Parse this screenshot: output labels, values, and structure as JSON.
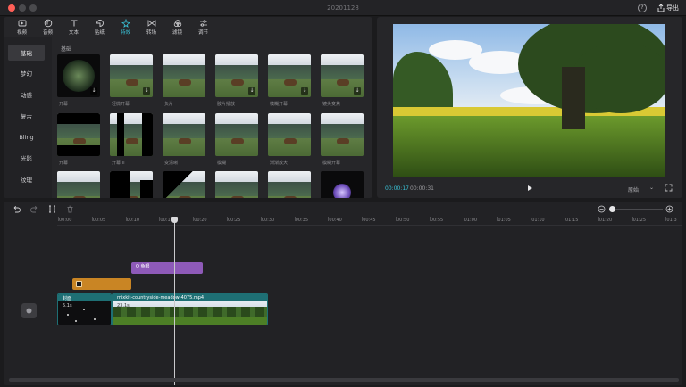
{
  "window": {
    "title": "20201128",
    "export_label": "导出",
    "help_label": "?"
  },
  "colors": {
    "accent": "#39c2d7",
    "text_clip": "#8e5ab8",
    "sticker_clip": "#c98524",
    "video_clip": "#1e6f74"
  },
  "tabs": [
    {
      "label": "视频",
      "icon": "video-icon"
    },
    {
      "label": "音频",
      "icon": "music-icon"
    },
    {
      "label": "文本",
      "icon": "text-icon"
    },
    {
      "label": "贴纸",
      "icon": "sticker-icon"
    },
    {
      "label": "特效",
      "icon": "effects-icon",
      "active": true
    },
    {
      "label": "转场",
      "icon": "transition-icon"
    },
    {
      "label": "滤镜",
      "icon": "filter-icon"
    },
    {
      "label": "调节",
      "icon": "adjust-icon"
    }
  ],
  "categories": [
    {
      "label": "基础",
      "active": true
    },
    {
      "label": "梦幻"
    },
    {
      "label": "动感"
    },
    {
      "label": "复古"
    },
    {
      "label": "Bling"
    },
    {
      "label": "光影"
    },
    {
      "label": "纹理"
    },
    {
      "label": "漫画"
    }
  ],
  "effects": {
    "section_label": "基础",
    "items": [
      {
        "label": "开幕",
        "variant": "circle",
        "downloaded": false
      },
      {
        "label": "轻微开幕",
        "variant": "plain"
      },
      {
        "label": "负片",
        "variant": "plain"
      },
      {
        "label": "胶片播放",
        "variant": "plain"
      },
      {
        "label": "模糊开幕",
        "variant": "plain"
      },
      {
        "label": "镜头变焦",
        "variant": "plain"
      },
      {
        "label": "开幕",
        "variant": "black-bars"
      },
      {
        "label": "开幕 II",
        "variant": "split"
      },
      {
        "label": "变清晰",
        "variant": "plain"
      },
      {
        "label": "模糊",
        "variant": "plain"
      },
      {
        "label": "渐渐放大",
        "variant": "plain"
      },
      {
        "label": "模糊开幕",
        "variant": "plain"
      },
      {
        "label": "",
        "variant": "plain"
      },
      {
        "label": "",
        "variant": "split2"
      },
      {
        "label": "",
        "variant": "diagonal"
      },
      {
        "label": "",
        "variant": "plain"
      },
      {
        "label": "",
        "variant": "plain"
      },
      {
        "label": "",
        "variant": "orb"
      }
    ]
  },
  "preview": {
    "current_time": "00:00:17",
    "total_time": "00:00:31",
    "ratio_label": "原始"
  },
  "timeline": {
    "ruler_labels": [
      "00:00",
      "00:05",
      "00:10",
      "00:15",
      "00:20",
      "00:25",
      "00:30",
      "00:35",
      "00:40",
      "00:45",
      "00:50",
      "00:55",
      "01:00",
      "01:05",
      "01:10",
      "01:15",
      "01:20",
      "01:25",
      "01:3"
    ],
    "text_clip_label": "Q 鱼眼",
    "sticker_clip_label": "",
    "cover_clip_label": "封面",
    "cover_duration": "5.1s",
    "video_clip_label": "mixkit-countryside-meadow-4075.mp4",
    "video_duration": "23.1s"
  }
}
